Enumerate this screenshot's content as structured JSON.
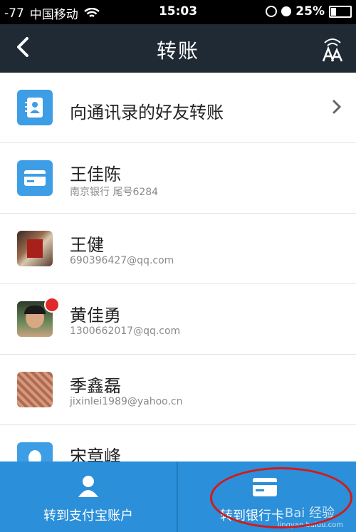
{
  "status_bar": {
    "signal": "-77",
    "carrier": "中国移动",
    "time": "15:03",
    "battery": "25%"
  },
  "nav": {
    "back_icon": "chevron-left-icon",
    "title": "转账",
    "font_icon": "font-size-icon"
  },
  "list": {
    "contacts_entry": {
      "label": "向通讯录的好友转账",
      "icon": "address-book-icon"
    },
    "items": [
      {
        "name": "王佳陈",
        "detail": "南京银行  尾号6284",
        "icon": "bank-card-icon"
      },
      {
        "name": "王健",
        "detail": "690396427@qq.com",
        "avatar": "photo-avatar"
      },
      {
        "name": "黄佳勇",
        "detail": "1300662017@qq.com",
        "avatar": "photo-avatar"
      },
      {
        "name": "季鑫磊",
        "detail": "jixinlei1989@yahoo.cn",
        "avatar": "photo-avatar"
      },
      {
        "name": "宋章峰",
        "detail": "",
        "avatar": "default-avatar"
      }
    ]
  },
  "tabbar": {
    "tabs": [
      {
        "label": "转到支付宝账户",
        "icon": "person-icon"
      },
      {
        "label": "转到银行卡",
        "icon": "bank-card-icon"
      }
    ],
    "watermark": "Bai  经验",
    "watermark_url": "jingyan.baidu.com"
  },
  "colors": {
    "accent": "#2b8fd9",
    "nav_bg": "#1f2a35",
    "highlight": "#d31a1a"
  }
}
